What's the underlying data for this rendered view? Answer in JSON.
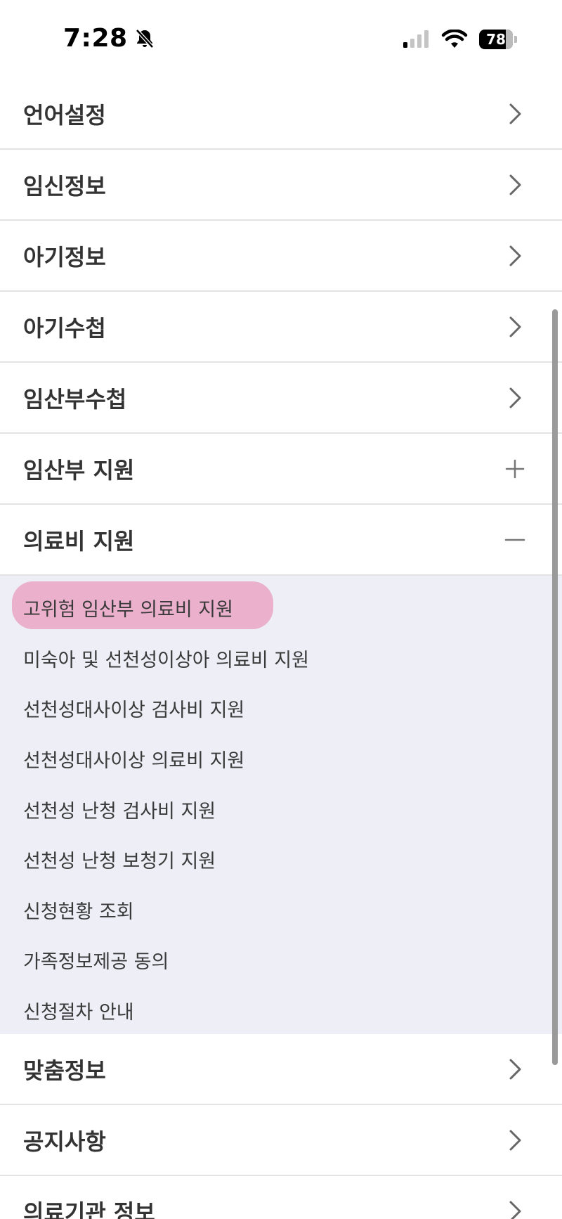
{
  "status_bar": {
    "time": "7:28",
    "battery": "78"
  },
  "menu": {
    "items_top": [
      {
        "label": "언어설정",
        "indicator": "chevron-right"
      },
      {
        "label": "임신정보",
        "indicator": "chevron-right"
      },
      {
        "label": "아기정보",
        "indicator": "chevron-right"
      },
      {
        "label": "아기수첩",
        "indicator": "chevron-right"
      },
      {
        "label": "임산부수첩",
        "indicator": "chevron-right"
      },
      {
        "label": "임산부 지원",
        "indicator": "plus"
      },
      {
        "label": "의료비 지원",
        "indicator": "minus"
      }
    ],
    "submenu": [
      {
        "label": "고위험 임산부 의료비 지원"
      },
      {
        "label": "미숙아 및 선천성이상아 의료비 지원"
      },
      {
        "label": "선천성대사이상 검사비 지원"
      },
      {
        "label": "선천성대사이상 의료비 지원"
      },
      {
        "label": "선천성 난청 검사비 지원"
      },
      {
        "label": "선천성 난청 보청기 지원"
      },
      {
        "label": "신청현황 조회"
      },
      {
        "label": "가족정보제공 동의"
      },
      {
        "label": "신청절차 안내"
      }
    ],
    "items_bottom": [
      {
        "label": "맞춤정보",
        "indicator": "chevron-right"
      },
      {
        "label": "공지사항",
        "indicator": "chevron-right"
      },
      {
        "label": "의료기관 정보",
        "indicator": "chevron-right"
      }
    ]
  },
  "colors": {
    "submenu_bg": "#edeef6",
    "highlight": "#e9a9c8",
    "divider": "#e3e3e3",
    "text": "#333333"
  }
}
